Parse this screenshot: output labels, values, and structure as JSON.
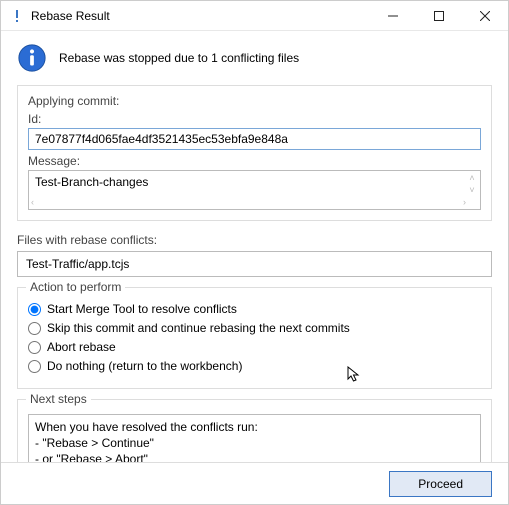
{
  "window": {
    "title": "Rebase Result"
  },
  "info": {
    "message": "Rebase was stopped due to 1 conflicting files"
  },
  "applying": {
    "group_label": "Applying commit:",
    "id_label": "Id:",
    "id_value": "7e07877f4d065fae4df3521435ec53ebfa9e848a",
    "message_label": "Message:",
    "message_value": "Test-Branch-changes"
  },
  "conflicts": {
    "label": "Files with rebase conflicts:",
    "file": "Test-Traffic/app.tcjs"
  },
  "actions": {
    "group_label": "Action to perform",
    "options": [
      "Start Merge Tool to resolve conflicts",
      "Skip this commit and continue rebasing the next commits",
      "Abort rebase",
      "Do nothing (return to the workbench)"
    ],
    "selected_index": 0
  },
  "next_steps": {
    "group_label": "Next steps",
    "line1": "When you have resolved the conflicts run:",
    "line2": "- \"Rebase > Continue\"",
    "line3": "- or \"Rebase > Abort\""
  },
  "footer": {
    "proceed_label": "Proceed"
  }
}
